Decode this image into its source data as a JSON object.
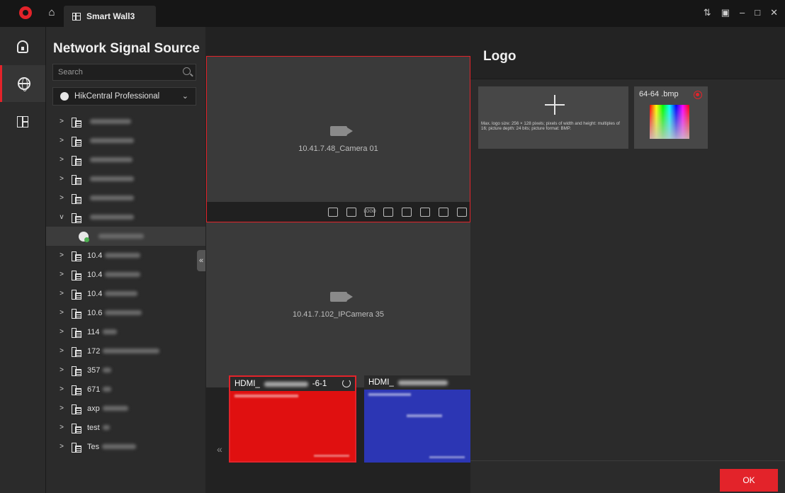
{
  "titlebar": {
    "tab_label": "Smart Wall3"
  },
  "rail": {
    "items": [
      "access-control",
      "network",
      "layout"
    ]
  },
  "source_panel": {
    "title": "Network Signal Source",
    "search_placeholder": "Search",
    "site_select": "HikCentral Professional",
    "tree": [
      {
        "caret": ">",
        "label": "",
        "blur": 58
      },
      {
        "caret": ">",
        "label": "",
        "blur": 62
      },
      {
        "caret": ">",
        "label": "",
        "blur": 60
      },
      {
        "caret": ">",
        "label": "",
        "blur": 62
      },
      {
        "caret": ">",
        "label": "",
        "blur": 62
      },
      {
        "caret": "v",
        "label": "",
        "blur": 62
      },
      {
        "caret": "",
        "label": "",
        "blur": 64,
        "child": true
      },
      {
        "caret": ">",
        "label": "10.4",
        "blur": 50
      },
      {
        "caret": ">",
        "label": "10.4",
        "blur": 50
      },
      {
        "caret": ">",
        "label": "10.4",
        "blur": 46
      },
      {
        "caret": ">",
        "label": "10.6",
        "blur": 52
      },
      {
        "caret": ">",
        "label": "114",
        "blur": 20
      },
      {
        "caret": ">",
        "label": "172",
        "blur": 80
      },
      {
        "caret": ">",
        "label": "357",
        "blur": 12
      },
      {
        "caret": ">",
        "label": "671",
        "blur": 12
      },
      {
        "caret": ">",
        "label": "axp",
        "blur": 36
      },
      {
        "caret": ">",
        "label": "test",
        "blur": 10
      },
      {
        "caret": ">",
        "label": "Tes",
        "blur": 48
      }
    ]
  },
  "wall": {
    "window1_label": "10.41.7.48_Camera 01",
    "window2_label": "10.41.7.102_IPCamera 35",
    "toolbar_logo": "LOGO"
  },
  "outputs": [
    {
      "name": "HDMI_",
      "suffix": "-6-1"
    },
    {
      "name": "HDMI_",
      "suffix": ""
    }
  ],
  "logo_dialog": {
    "title": "Logo",
    "hint": "Max. logo size: 256 × 128 pixels; pixels of width and height: multiples of 16; picture depth: 24 bits; picture format: BMP.",
    "image_name": "64-64 .bmp",
    "ok_label": "OK"
  }
}
